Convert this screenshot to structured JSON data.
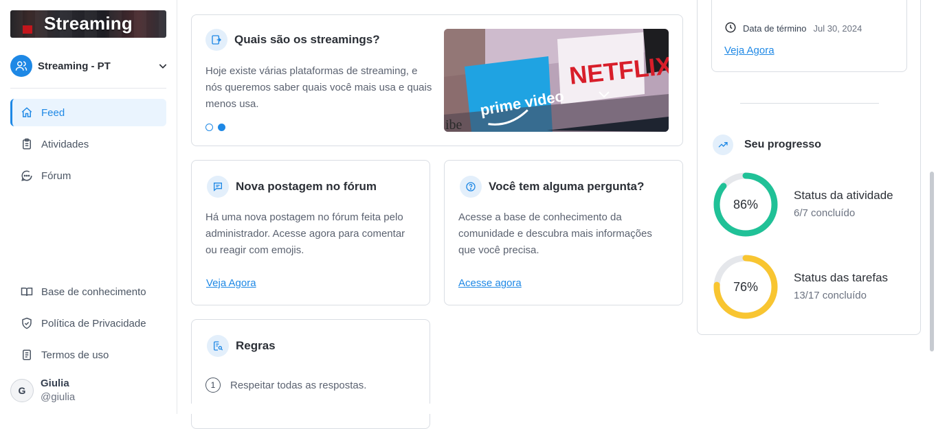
{
  "brand": {
    "title": "Streaming"
  },
  "workspace": {
    "name": "Streaming - PT"
  },
  "nav": {
    "items": [
      {
        "label": "Feed",
        "icon": "home-icon",
        "active": true
      },
      {
        "label": "Atividades",
        "icon": "clipboard-icon",
        "active": false
      },
      {
        "label": "Fórum",
        "icon": "chat-icon",
        "active": false
      }
    ]
  },
  "footer_nav": {
    "items": [
      {
        "label": "Base de conhecimento",
        "icon": "book-icon"
      },
      {
        "label": "Política de Privacidade",
        "icon": "shield-icon"
      },
      {
        "label": "Termos de uso",
        "icon": "document-icon"
      }
    ]
  },
  "user": {
    "initial": "G",
    "name": "Giulia",
    "handle": "@giulia"
  },
  "hero": {
    "title": "Quais são os streamings?",
    "text": "Hoje existe várias plataformas de streaming, e nós queremos saber quais você mais usa e quais menos usa.",
    "image_label_netflix": "NETFLIX",
    "image_label_prime": "prime video",
    "image_label_bottom": "ibe"
  },
  "forum_card": {
    "title": "Nova postagem no fórum",
    "text": "Há uma nova postagem no fórum feita pelo administrador. Acesse agora para comentar ou reagir com emojis.",
    "link": "Veja Agora"
  },
  "question_card": {
    "title": "Você tem alguma pergunta?",
    "text": "Acesse a base de conhecimento da comunidade e descubra mais informações que você precisa.",
    "link": "Acesse agora"
  },
  "rules_card": {
    "title": "Regras",
    "rules": [
      {
        "num": "1",
        "text": "Respeitar todas as respostas."
      }
    ]
  },
  "activity_card": {
    "end_label": "Data de término",
    "end_value": "Jul 30, 2024",
    "link": "Veja Agora"
  },
  "progress": {
    "title": "Seu progresso",
    "items": [
      {
        "percent_label": "86%",
        "percent": 86,
        "title": "Status da atividade",
        "sub": "6/7 concluído",
        "color": "#20c197"
      },
      {
        "percent_label": "76%",
        "percent": 76,
        "title": "Status das tarefas",
        "sub": "13/17 concluído",
        "color": "#f8c531"
      }
    ]
  },
  "colors": {
    "accent": "#1e88e5",
    "border": "#d9dde3"
  }
}
